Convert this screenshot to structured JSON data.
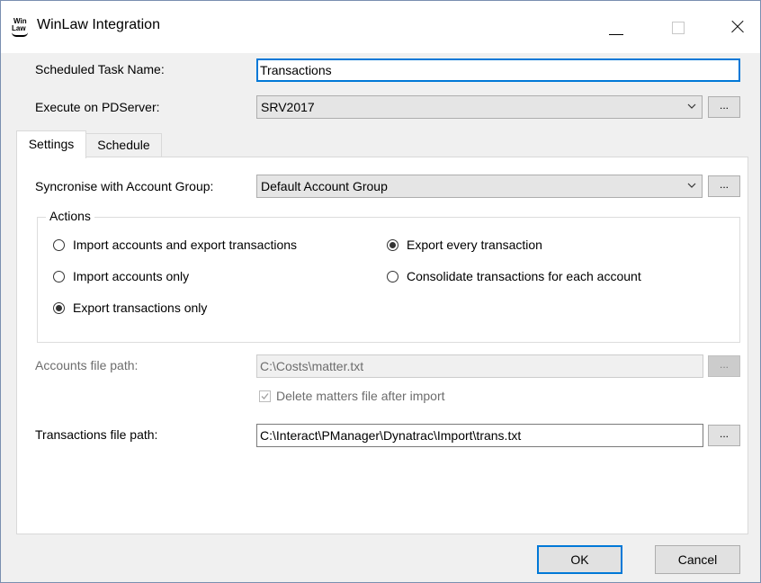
{
  "window": {
    "title": "WinLaw Integration",
    "icon_text_top": "Win",
    "icon_text_bottom": "Law"
  },
  "task": {
    "name_label": "Scheduled Task Name:",
    "name_value": "Transactions",
    "server_label": "Execute on PDServer:",
    "server_value": "SRV2017"
  },
  "tabs": [
    {
      "label": "Settings",
      "active": true
    },
    {
      "label": "Schedule",
      "active": false
    }
  ],
  "settings": {
    "account_group_label": "Syncronise with Account Group:",
    "account_group_value": "Default Account Group",
    "actions": {
      "legend": "Actions",
      "mode_options": [
        {
          "label": "Import accounts and export transactions",
          "checked": false
        },
        {
          "label": "Import accounts only",
          "checked": false
        },
        {
          "label": "Export transactions only",
          "checked": true
        }
      ],
      "export_options": [
        {
          "label": "Export every transaction",
          "checked": true
        },
        {
          "label": "Consolidate transactions for each account",
          "checked": false
        }
      ]
    },
    "accounts_path_label": "Accounts file path:",
    "accounts_path_value": "C:\\Costs\\matter.txt",
    "delete_matters_label": "Delete matters file after import",
    "transactions_path_label": "Transactions file path:",
    "transactions_path_value": "C:\\Interact\\PManager\\Dynatrac\\Import\\trans.txt"
  },
  "browse_label": "...",
  "buttons": {
    "ok_label": "OK",
    "cancel_label": "Cancel"
  }
}
